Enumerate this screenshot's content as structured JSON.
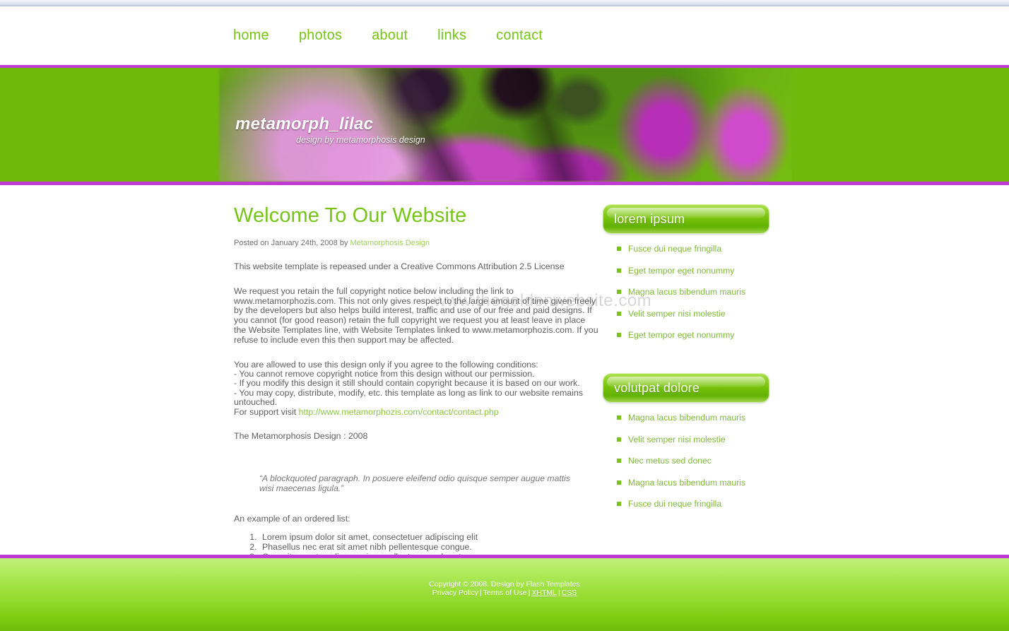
{
  "nav": {
    "items": [
      {
        "label": "home"
      },
      {
        "label": "photos"
      },
      {
        "label": "about"
      },
      {
        "label": "links"
      },
      {
        "label": "contact"
      }
    ]
  },
  "banner": {
    "title": "metamorph_lilac",
    "subtitle": "design by metamorphosis design",
    "accent_color": "#c03bd4",
    "green_color": "#6fb80c"
  },
  "watermark": {
    "text": "www.thegoldenwebsite.com"
  },
  "main": {
    "heading": "Welcome To Our Website",
    "meta_prefix": "Posted on January 24th, 2008 by ",
    "meta_author": "Metamorphosis Design",
    "paragraph_1": "This website template is repeased under a Creative Commons Attribution 2.5 License",
    "paragraph_2": "We request you retain the full copyright notice below including the link to www.metamorphozis.com. This not only gives respect to the large amount of time given freely by the developers but also helps build interest, traffic and use of our free and paid designs. If you cannot (for good reason) retain the full copyright we request you at least leave in place the Website Templates line, with Website Templates linked to www.metamorphozis.com. If you refuse to include even this then support may be affected.",
    "conditions_intro": "You are allowed to use this design only if you agree to the following conditions:",
    "condition_1": "- You cannot remove copyright notice from this design without our permission.",
    "condition_2": "- If you modify this design it still should contain copyright because it is based on our work.",
    "condition_3": "- You may copy, distribute, modify, etc. this template as long as link to our website remains untouched.",
    "support_prefix": "For support visit ",
    "support_link": "http://www.metamorphozis.com/contact/contact.php",
    "signature": "The Metamorphosis Design : 2008",
    "blockquote": "“A blockquoted paragraph. In posuere eleifend odio quisque semper augue mattis wisi maecenas ligula.”",
    "list_intro": "An example of an ordered list:",
    "ordered_list": [
      "Lorem ipsum dolor sit amet, consectetuer adipiscing elit",
      "Phasellus nec erat sit amet nibh pellentesque congue.",
      "Cras vitae metus aliquam risus pellentesque pharetra."
    ]
  },
  "sidebar": {
    "widgets": [
      {
        "title": "lorem ipsum",
        "items": [
          "Fusce dui neque fringilla",
          "Eget tempor eget nonummy",
          "Magna lacus bibendum mauris",
          "Velit semper nisi molestie",
          "Eget tempor eget nonummy"
        ]
      },
      {
        "title": "volutpat dolore",
        "items": [
          "Magna lacus bibendum mauris",
          "Velit semper nisi molestie",
          "Nec metus sed donec",
          "Magna lacus bibendum mauris",
          "Fusce dui neque fringilla"
        ]
      }
    ]
  },
  "footer": {
    "copyright": "Copyright © 2008. Design by Flash Templates",
    "privacy_label": "Privacy Policy",
    "terms_label": "Terms of Use",
    "xhtml_label": "XHTML",
    "css_label": "CSS",
    "separator": "|"
  }
}
